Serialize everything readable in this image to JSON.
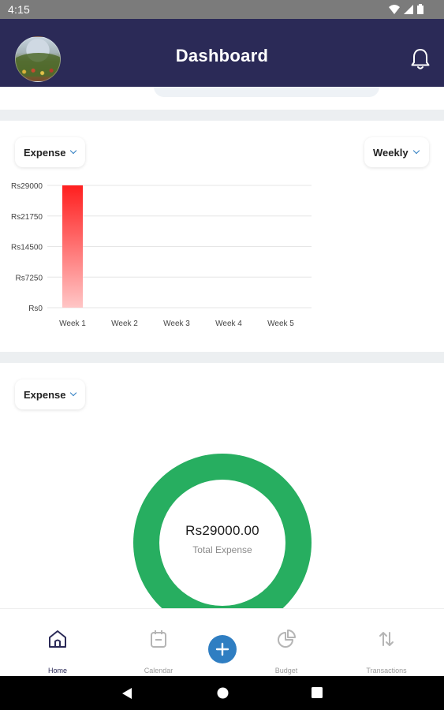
{
  "status_bar": {
    "time": "4:15"
  },
  "header": {
    "title": "Dashboard"
  },
  "bar_section": {
    "type_dropdown": "Expense",
    "period_dropdown": "Weekly"
  },
  "chart_data": {
    "type": "bar",
    "categories": [
      "Week 1",
      "Week 2",
      "Week 3",
      "Week 4",
      "Week 5"
    ],
    "values": [
      29000,
      0,
      0,
      0,
      0
    ],
    "y_ticks": [
      "Rs0",
      "Rs7250",
      "Rs14500",
      "Rs21750",
      "Rs29000"
    ],
    "ylim": [
      0,
      29000
    ],
    "grid": true,
    "bar_color": "#ff1f1f"
  },
  "donut_section": {
    "type_dropdown": "Expense",
    "amount": "Rs29000.00",
    "label": "Total Expense",
    "color": "#27ae60"
  },
  "bottom_nav": {
    "items": [
      {
        "label": "Home",
        "icon": "home-icon",
        "active": true
      },
      {
        "label": "Calendar",
        "icon": "calendar-icon",
        "active": false
      },
      {
        "label": "Budget",
        "icon": "pie-chart-icon",
        "active": false
      },
      {
        "label": "Transactions",
        "icon": "transfer-arrows-icon",
        "active": false
      }
    ],
    "fab_icon": "plus-icon"
  },
  "colors": {
    "header_bg": "#2b2a57",
    "accent": "#2f7ec2"
  }
}
